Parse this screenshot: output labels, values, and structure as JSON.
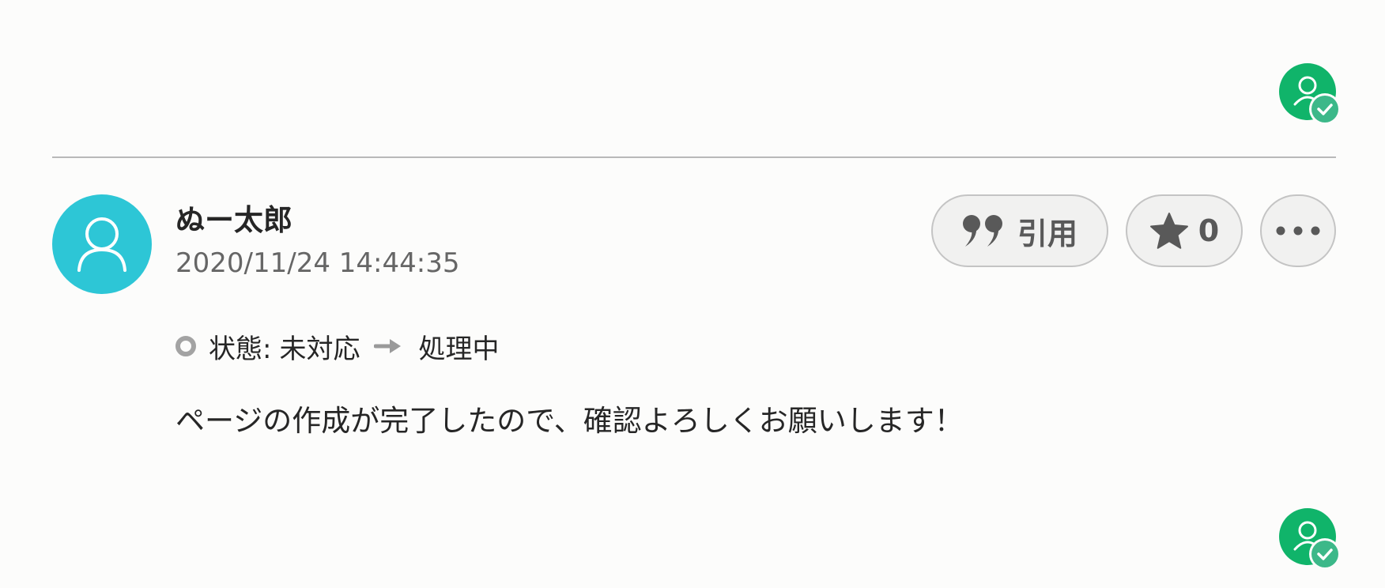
{
  "comment": {
    "author": "ぬー太郎",
    "timestamp": "2020/11/24 14:44:35",
    "status": {
      "label": "状態:",
      "from": "未対応",
      "to": "処理中"
    },
    "body": "ページの作成が完了したので、確認よろしくお願いします！"
  },
  "actions": {
    "quote_label": "引用",
    "star_count": "0"
  },
  "colors": {
    "avatar": "#2dc6d6",
    "read_badge": "#10b46a",
    "accent_check": "#3cb889"
  },
  "icons": {
    "quote": "quote-icon",
    "star": "star-icon",
    "more": "ellipsis-icon",
    "user": "user-icon",
    "read_check": "check-icon",
    "arrow": "arrow-right-icon"
  }
}
